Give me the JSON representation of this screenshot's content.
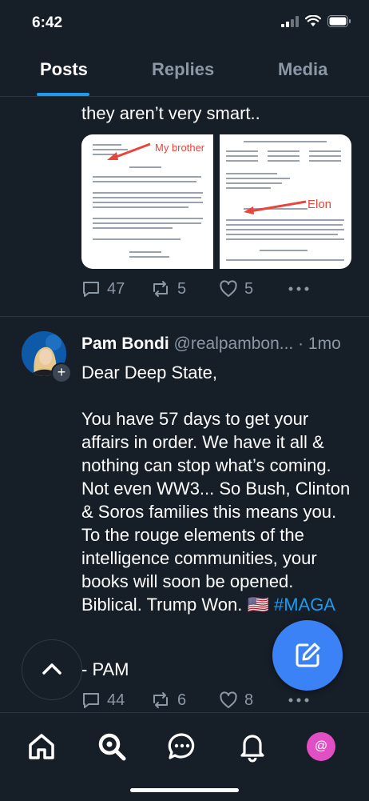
{
  "status_bar": {
    "time": "6:42",
    "icons": [
      "cellular-signal-icon",
      "wifi-icon",
      "battery-icon"
    ]
  },
  "tabs": [
    {
      "label": "Posts",
      "active": true
    },
    {
      "label": "Replies",
      "active": false
    },
    {
      "label": "Media",
      "active": false
    }
  ],
  "previous_post": {
    "text": "they aren’t very smart..",
    "attachments": [
      {
        "annotation": "My brother"
      },
      {
        "annotation": "Elon"
      }
    ],
    "stats": {
      "replies": "47",
      "reposts": "5",
      "likes": "5"
    }
  },
  "post": {
    "author": "Pam Bondi",
    "handle": "@realpambon...",
    "time": "· 1mo",
    "body_main": "Dear Deep State,\n\nYou have 57 days to get your affairs in order. We have it all & nothing can stop what’s coming. Not even WW3... So Bush, Clinton & Soros families this means you. To the rouge elements of the intelligence communities, your books will soon be opened. Biblical. Trump Won. 🇺🇸 ",
    "hashtag": "#MAGA",
    "signoff": "- PAM",
    "stats": {
      "replies": "44",
      "reposts": "6",
      "likes": "8"
    }
  },
  "colors": {
    "background": "#161e27",
    "accent": "#1d9bf0",
    "fab": "#3b82f6",
    "profile": "#e24fc4"
  },
  "bottom_nav": [
    "home-icon",
    "search-icon",
    "chat-icon",
    "bell-icon",
    "profile-icon"
  ]
}
